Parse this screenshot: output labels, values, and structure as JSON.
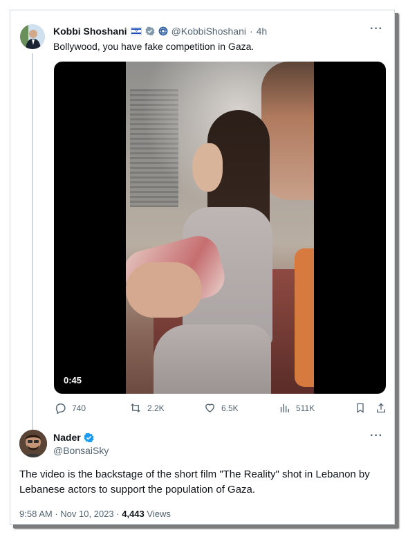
{
  "tweet1": {
    "author_name": "Kobbi Shoshani",
    "handle": "@KobbiShoshani",
    "separator": "·",
    "time": "4h",
    "text": "Bollywood, you have fake competition in Gaza.",
    "video_duration": "0:45",
    "stats": {
      "replies": "740",
      "reposts": "2.2K",
      "likes": "6.5K",
      "views": "511K"
    },
    "icons": [
      "israel-flag-icon",
      "verified-grey-icon",
      "government-badge-icon",
      "more-icon",
      "reply-icon",
      "repost-icon",
      "like-icon",
      "views-icon",
      "bookmark-icon",
      "share-icon"
    ]
  },
  "tweet2": {
    "author_name": "Nader",
    "handle": "@BonsaiSky",
    "text": "The video is the backstage of the short film \"The Reality\" shot in Lebanon by Lebanese actors to support the population of Gaza.",
    "time": "9:58 AM",
    "date": "Nov 10, 2023",
    "separator": "·",
    "views_count": "4,443",
    "views_label": "Views"
  },
  "colors": {
    "text_primary": "#0f1419",
    "text_secondary": "#536471",
    "verified_blue": "#1d9bf0",
    "border": "#cfd9de"
  }
}
